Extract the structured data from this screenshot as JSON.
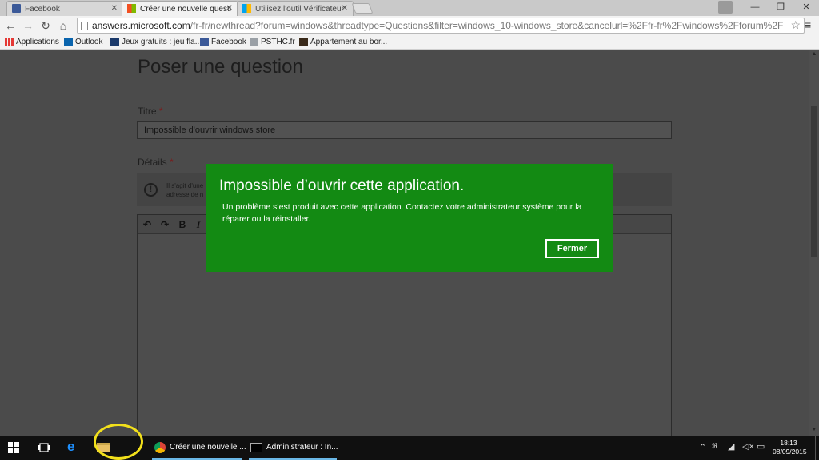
{
  "browser": {
    "tabs": [
      {
        "title": "Facebook",
        "active": false
      },
      {
        "title": "Créer une nouvelle questi",
        "active": true
      },
      {
        "title": "Utilisez l'outil Vérificateur",
        "active": false
      }
    ],
    "url_host": "answers.microsoft.com",
    "url_rest": "/fr-fr/newthread?forum=windows&threadtype=Questions&filter=windows_10-windows_store&cancelurl=%2Ffr-fr%2Fwindows%2Fforum%2F",
    "bookmarks": [
      {
        "label": "Applications",
        "icon": "apps-grid-icon"
      },
      {
        "label": "Outlook",
        "icon": "outlook-icon"
      },
      {
        "label": "Jeux gratuits : jeu fla...",
        "icon": "games-icon"
      },
      {
        "label": "Facebook",
        "icon": "facebook-icon"
      },
      {
        "label": "PSTHC.fr",
        "icon": "psthc-icon"
      },
      {
        "label": "Appartement au bor...",
        "icon": "bookmark-icon"
      }
    ]
  },
  "page": {
    "heading": "Poser une question",
    "title_label": "Titre",
    "title_value": "Impossible d'ouvrir windows store",
    "details_label": "Détails",
    "required_mark": "*",
    "info_text": "Il s'agit d'une adresse de n",
    "editor_buttons": [
      "↶",
      "↷",
      "B",
      "I"
    ]
  },
  "dialog": {
    "title": "Impossible d’ouvrir cette application.",
    "message": "Un problème s’est produit avec cette application. Contactez votre administrateur système pour la réparer ou la réinstaller.",
    "close_button": "Fermer",
    "color": "#138a13"
  },
  "taskbar": {
    "tasks": [
      {
        "label": "Créer une nouvelle ...",
        "icon": "chrome-icon"
      },
      {
        "label": "Administrateur : In...",
        "icon": "console-icon"
      }
    ],
    "time": "18:13",
    "date": "08/09/2015"
  }
}
